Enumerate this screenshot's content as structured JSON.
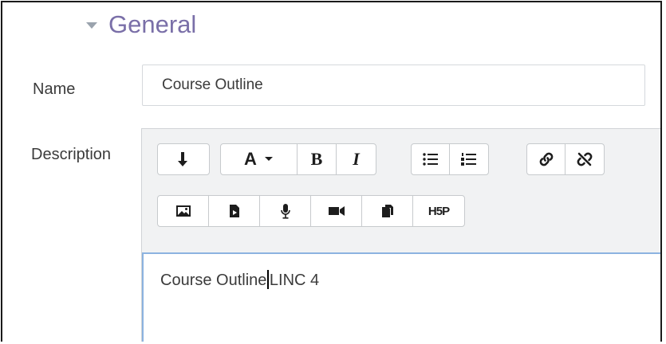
{
  "section": {
    "title": "General"
  },
  "name_field": {
    "label": "Name",
    "value": "Course Outline"
  },
  "description_field": {
    "label": "Description",
    "content_before_cursor": "Course Outline",
    "content_after_cursor": "LINC 4"
  },
  "toolbar": {
    "row1": [
      {
        "icon": "collapse-toolbar-icon"
      },
      {
        "icon": "font-color-icon",
        "label": "A",
        "has_dropdown": true
      },
      {
        "icon": "bold-icon",
        "label": "B"
      },
      {
        "icon": "italic-icon",
        "label": "I"
      },
      {
        "icon": "unordered-list-icon"
      },
      {
        "icon": "ordered-list-icon"
      },
      {
        "icon": "link-icon"
      },
      {
        "icon": "unlink-icon"
      }
    ],
    "row2": [
      {
        "icon": "image-icon"
      },
      {
        "icon": "media-file-icon"
      },
      {
        "icon": "record-audio-icon"
      },
      {
        "icon": "record-video-icon"
      },
      {
        "icon": "manage-files-icon"
      },
      {
        "icon": "h5p-icon",
        "label": "H5P"
      }
    ]
  },
  "colors": {
    "section_title": "#7a6fa8",
    "focus_border": "#8cb3e0",
    "toolbar_background": "#f1f2f3"
  }
}
